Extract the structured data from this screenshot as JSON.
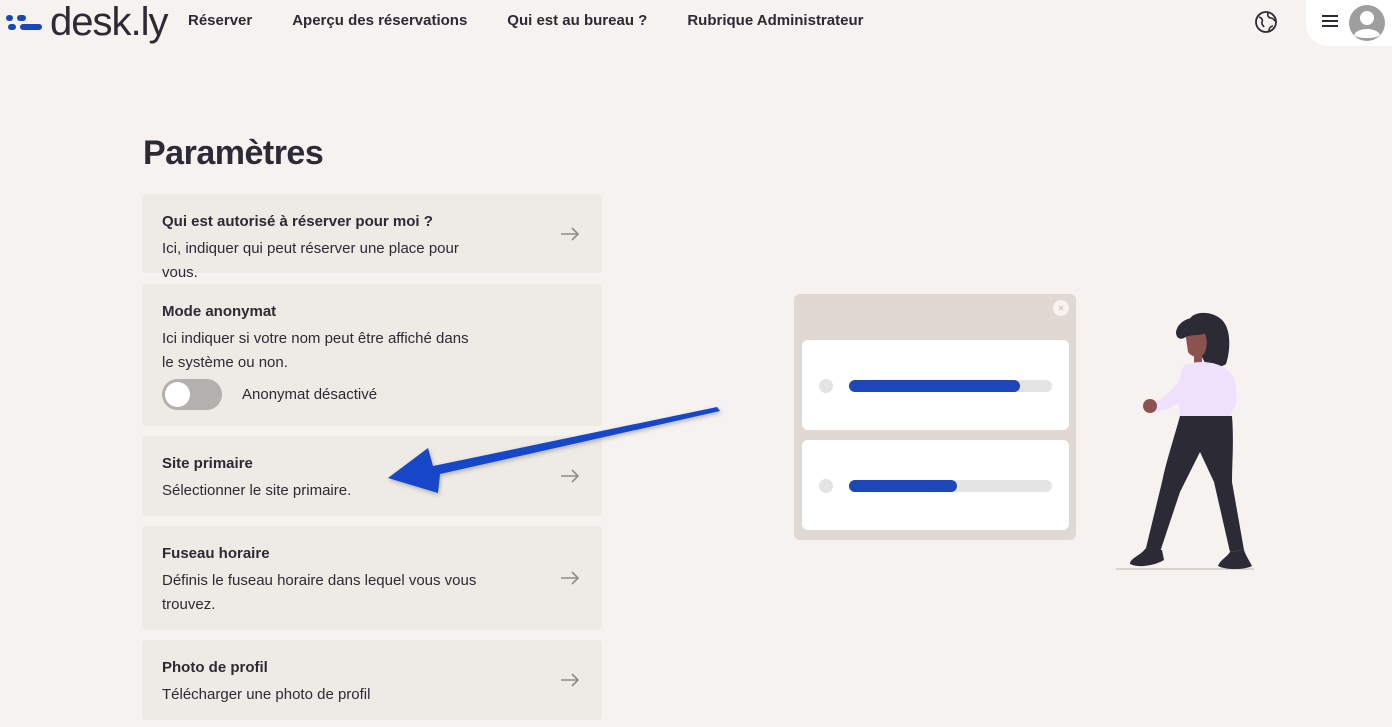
{
  "header": {
    "logo_text": "desk.ly",
    "nav": [
      {
        "label": "Réserver"
      },
      {
        "label": "Aperçu des réservations"
      },
      {
        "label": "Qui est au bureau ?"
      },
      {
        "label": "Rubrique Administrateur"
      }
    ],
    "icons": {
      "language": "globe-icon",
      "menu": "hamburger-menu-icon",
      "profile": "user-avatar-icon"
    }
  },
  "page": {
    "title": "Paramètres"
  },
  "settings": [
    {
      "title": "Qui est autorisé à réserver pour moi ?",
      "description": "Ici, indiquer qui peut réserver une place pour vous.",
      "action_icon": "arrow-right-icon"
    },
    {
      "title": "Mode anonymat",
      "description": "Ici indiquer si votre nom peut être affiché dans le système ou non.",
      "toggle": {
        "label": "Anonymat désactivé",
        "on": false
      }
    },
    {
      "title": "Site primaire",
      "description": "Sélectionner le site primaire.",
      "action_icon": "arrow-right-icon"
    },
    {
      "title": "Fuseau horaire",
      "description": "Définis le fuseau horaire dans lequel vous vous trouvez.",
      "action_icon": "arrow-right-icon"
    },
    {
      "title": "Photo de profil",
      "description": "Télécharger une photo de profil",
      "action_icon": "arrow-right-icon"
    }
  ],
  "illustration": {
    "close_glyph": "×",
    "bars": [
      {
        "fill": 0.84
      },
      {
        "fill": 0.53
      }
    ]
  },
  "colors": {
    "background": "#f5f2ef",
    "card": "#eeeae5",
    "accent": "#1d47b8",
    "text": "#2b2a35",
    "annotation_arrow": "#1547c8"
  }
}
